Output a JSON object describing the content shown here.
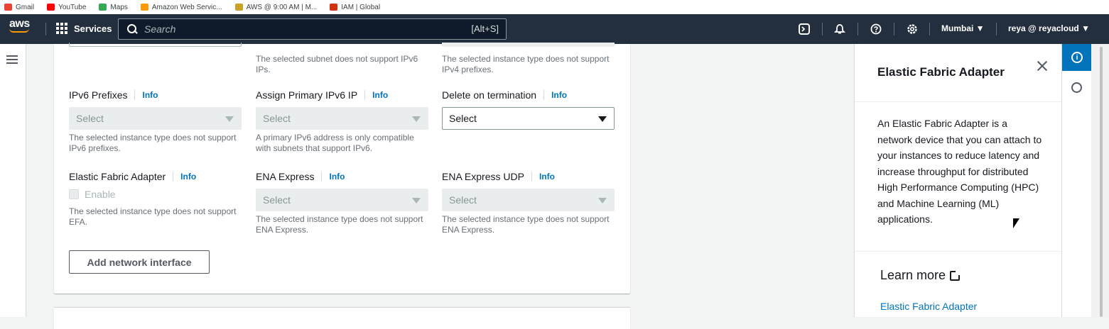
{
  "bookmarks": [
    {
      "label": "Gmail",
      "color": "#ea4335"
    },
    {
      "label": "YouTube",
      "color": "#ff0000"
    },
    {
      "label": "Maps",
      "color": "#34a853"
    },
    {
      "label": "Amazon Web Servic...",
      "color": "#ff9900"
    },
    {
      "label": "AWS @ 9:00 AM | M...",
      "color": "#c9a227"
    },
    {
      "label": "IAM | Global",
      "color": "#d13212"
    }
  ],
  "topnav": {
    "logo": "aws",
    "services_label": "Services",
    "search_placeholder": "Search",
    "search_shortcut": "[Alt+S]",
    "region": "Mumbai ▼",
    "account": "reya @ reyacloud ▼"
  },
  "form": {
    "row0": {
      "col2_desc": "The selected subnet does not support IPv6 IPs.",
      "col3_desc": "The selected instance type does not support IPv4 prefixes."
    },
    "ipv6_prefixes": {
      "label": "IPv6 Prefixes",
      "info": "Info",
      "value": "Select",
      "desc": "The selected instance type does not support IPv6 prefixes."
    },
    "assign_ipv6": {
      "label": "Assign Primary IPv6 IP",
      "info": "Info",
      "value": "Select",
      "desc": "A primary IPv6 address is only compatible with subnets that support IPv6."
    },
    "delete_on_termination": {
      "label": "Delete on termination",
      "info": "Info",
      "value": "Select"
    },
    "efa": {
      "label": "Elastic Fabric Adapter",
      "info": "Info",
      "checkbox_label": "Enable",
      "desc": "The selected instance type does not support EFA."
    },
    "ena_express": {
      "label": "ENA Express",
      "info": "Info",
      "value": "Select",
      "desc": "The selected instance type does not support ENA Express."
    },
    "ena_express_udp": {
      "label": "ENA Express UDP",
      "info": "Info",
      "value": "Select",
      "desc": "The selected instance type does not support ENA Express."
    },
    "add_button": "Add network interface"
  },
  "help_panel": {
    "title": "Elastic Fabric Adapter",
    "body": "An Elastic Fabric Adapter is a network device that you can attach to your instances to reduce latency and increase throughput for distributed High Performance Computing (HPC) and Machine Learning (ML) applications.",
    "learn_more": "Learn more",
    "link": "Elastic Fabric Adapter"
  },
  "colors": {
    "nav_bg": "#232f3e",
    "accent_blue": "#0073bb",
    "aws_orange": "#ff9900"
  }
}
